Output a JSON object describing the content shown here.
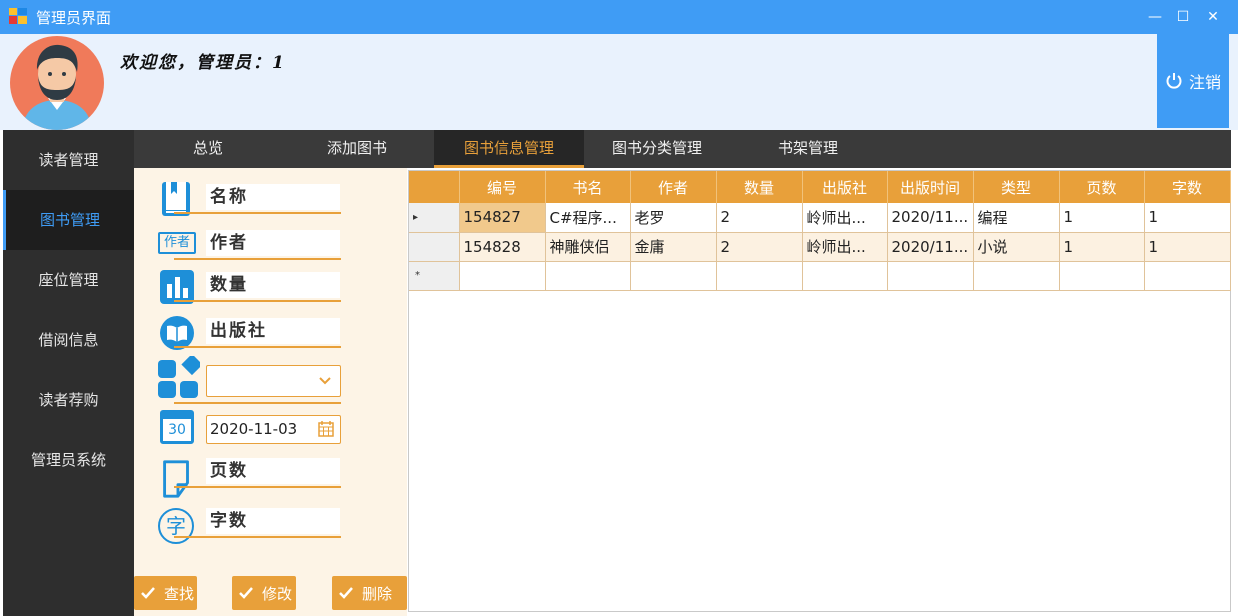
{
  "window": {
    "title": "管理员界面",
    "controls": [
      "—",
      "☐",
      "✕"
    ]
  },
  "header": {
    "welcome": "欢迎您，管理员：1",
    "logout_label": "注销"
  },
  "sidebar": {
    "items": [
      {
        "label": "读者管理"
      },
      {
        "label": "图书管理",
        "active": true
      },
      {
        "label": "座位管理"
      },
      {
        "label": "借阅信息"
      },
      {
        "label": "读者荐购"
      },
      {
        "label": "管理员系统"
      }
    ]
  },
  "tabs": [
    {
      "label": "总览"
    },
    {
      "label": "添加图书"
    },
    {
      "label": "图书信息管理",
      "active": true
    },
    {
      "label": "图书分类管理"
    },
    {
      "label": "书架管理"
    }
  ],
  "form": {
    "name_label": "名称",
    "author_label": "作者",
    "author_icon_text": "作者",
    "quantity_label": "数量",
    "publisher_label": "出版社",
    "category_value": "",
    "date_value": "2020-11-03",
    "calendar_icon_text": "30",
    "pages_label": "页数",
    "words_label": "字数",
    "words_icon_text": "字",
    "buttons": {
      "search": "查找",
      "edit": "修改",
      "delete": "删除"
    }
  },
  "grid": {
    "columns": [
      "编号",
      "书名",
      "作者",
      "数量",
      "出版社",
      "出版时间",
      "类型",
      "页数",
      "字数"
    ],
    "rows": [
      [
        "154827",
        "C#程序...",
        "老罗",
        "2",
        "岭师出...",
        "2020/11...",
        "编程",
        "1",
        "1"
      ],
      [
        "154828",
        "神雕侠侣",
        "金庸",
        "2",
        "岭师出...",
        "2020/11...",
        "小说",
        "1",
        "1"
      ]
    ],
    "new_row_marker": "*",
    "current_row_marker": "▸"
  },
  "colors": {
    "accent_blue": "#3f9cf5",
    "accent_orange": "#e8a03a",
    "sidebar_bg": "#2e2e2e",
    "form_bg": "#fdf4e6"
  }
}
